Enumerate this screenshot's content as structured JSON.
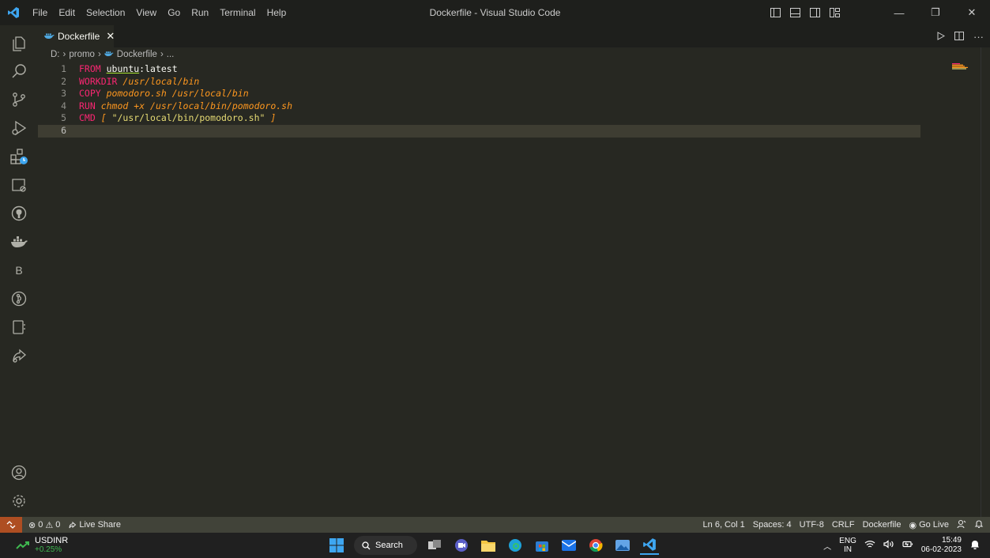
{
  "window": {
    "title": "Dockerfile - Visual Studio Code",
    "menu": [
      "File",
      "Edit",
      "Selection",
      "View",
      "Go",
      "Run",
      "Terminal",
      "Help"
    ],
    "controls": {
      "minimize": "—",
      "maximize": "❐",
      "close": "✕"
    }
  },
  "tab": {
    "label": "Dockerfile",
    "close": "✕"
  },
  "breadcrumb": [
    "D:",
    "promo",
    "Dockerfile",
    "..."
  ],
  "activity_icons": [
    "explorer-icon",
    "search-icon",
    "source-control-icon",
    "run-debug-icon",
    "remote-explorer-icon",
    "remote-icon",
    "github-icon",
    "docker-icon",
    "b-icon",
    "timeline-icon",
    "notebook-icon",
    "live-share-icon",
    "account-icon",
    "settings-gear-icon"
  ],
  "editor": {
    "lines": [
      {
        "num": "1",
        "parts": [
          {
            "t": "FROM ",
            "c": "kw"
          },
          {
            "t": "ubuntu",
            "c": "ul"
          },
          {
            "t": ":latest",
            "c": ""
          }
        ]
      },
      {
        "num": "2",
        "parts": [
          {
            "t": "WORKDIR ",
            "c": "kw"
          },
          {
            "t": "/usr/local/bin",
            "c": "it"
          }
        ]
      },
      {
        "num": "3",
        "parts": [
          {
            "t": "COPY ",
            "c": "kw"
          },
          {
            "t": "pomodoro.sh /usr/local/bin",
            "c": "it"
          }
        ]
      },
      {
        "num": "4",
        "parts": [
          {
            "t": "RUN ",
            "c": "kw"
          },
          {
            "t": "chmod +x /usr/local/bin/pomodoro.sh",
            "c": "it"
          }
        ]
      },
      {
        "num": "5",
        "parts": [
          {
            "t": "CMD ",
            "c": "kw"
          },
          {
            "t": "[ ",
            "c": "it"
          },
          {
            "t": "\"/usr/local/bin/pomodoro.sh\"",
            "c": "str"
          },
          {
            "t": " ]",
            "c": "it"
          }
        ]
      },
      {
        "num": "6",
        "parts": []
      }
    ],
    "current_line": 6
  },
  "statusbar": {
    "errors": "0",
    "warnings": "0",
    "live_share": "Live Share",
    "position": "Ln 6, Col 1",
    "spaces": "Spaces: 4",
    "encoding": "UTF-8",
    "eol": "CRLF",
    "language": "Dockerfile",
    "go_live": "Go Live"
  },
  "taskbar": {
    "ticker": "USDINR",
    "ticker_change": "+0.25%",
    "search": "Search",
    "lang_top": "ENG",
    "lang_bottom": "IN",
    "time": "15:49",
    "date": "06-02-2023"
  },
  "colors": {
    "editor_bg": "#272822",
    "keyword": "#f92672",
    "argument": "#fd971f",
    "string": "#e6db74",
    "status_bg": "#414339",
    "remote_bg": "#ae4e22"
  }
}
